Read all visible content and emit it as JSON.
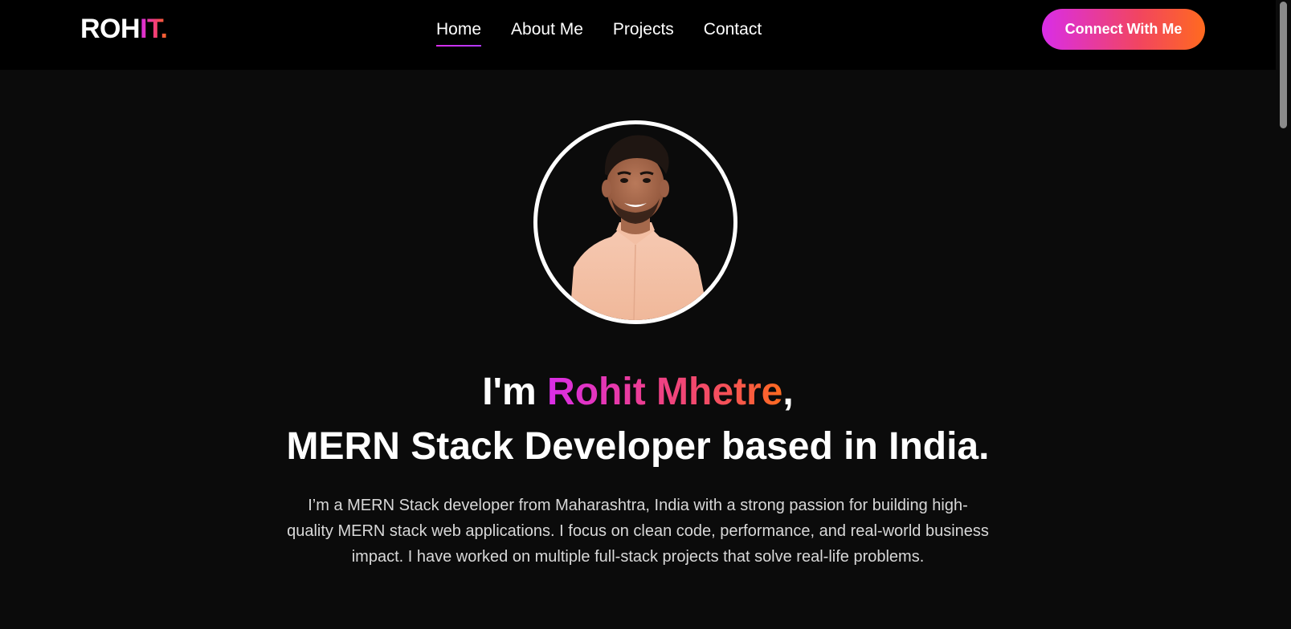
{
  "header": {
    "logo_main": "ROH",
    "logo_accent": "IT.",
    "nav": [
      {
        "label": "Home",
        "active": true
      },
      {
        "label": "About Me",
        "active": false
      },
      {
        "label": "Projects",
        "active": false
      },
      {
        "label": "Contact",
        "active": false
      }
    ],
    "cta_label": "Connect With Me"
  },
  "hero": {
    "greeting_prefix": "I'm ",
    "name": "Rohit Mhetre",
    "greeting_suffix": ",",
    "headline": "MERN Stack Developer based in India.",
    "description": "I’m a MERN Stack developer from Maharashtra, India with a strong passion for building high-quality MERN stack web applications. I focus on clean code, performance, and real-world business impact. I have worked on multiple full-stack projects that solve real-life problems.",
    "avatar_icon": "profile-photo"
  },
  "colors": {
    "background": "#0b0b0b",
    "header_bg": "#000000",
    "accent_start": "#d92de8",
    "accent_mid": "#f5406e",
    "accent_end": "#ff6a1f",
    "text": "#ffffff",
    "muted_text": "#d8d8d8"
  }
}
